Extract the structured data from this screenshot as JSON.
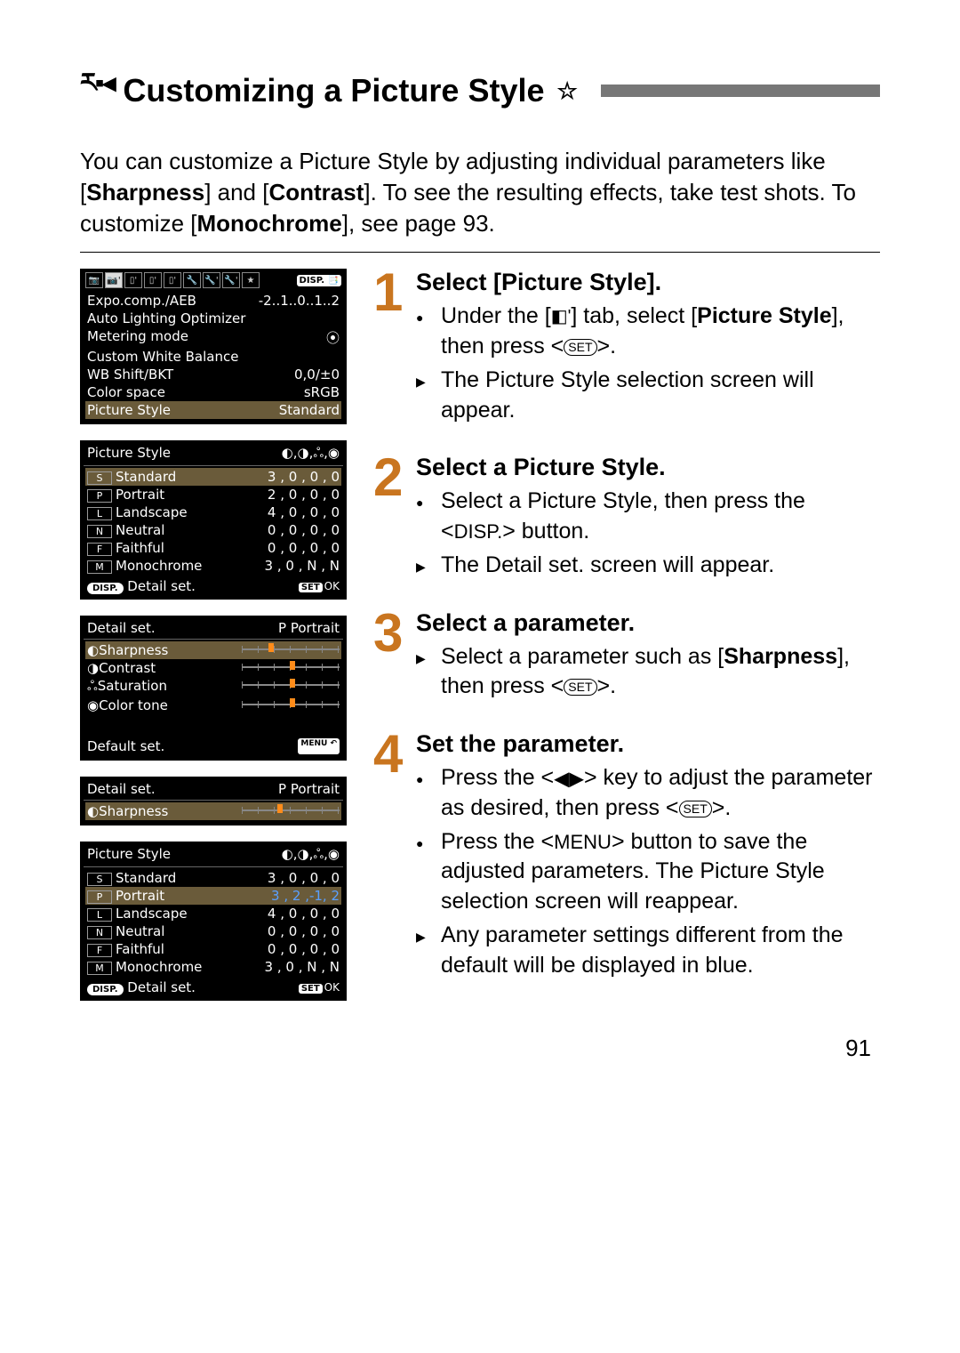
{
  "title": "Customizing a Picture Style",
  "intro_pre": "You can customize a Picture Style by adjusting individual parameters like [",
  "intro_b1": "Sharpness",
  "intro_mid": "] and [",
  "intro_b2": "Contrast",
  "intro_post": "]. To see the resulting effects, take test shots. To customize [",
  "intro_b3": "Monochrome",
  "intro_end": "], see page 93.",
  "page_number": "91",
  "screen1": {
    "disp_badge": "DISP. 📑",
    "rows": [
      {
        "label": "Expo.comp./AEB",
        "value": "-2..1..0..1..2"
      },
      {
        "label": "Auto Lighting Optimizer",
        "value": ""
      },
      {
        "label": "Metering mode",
        "value": "⦿"
      },
      {
        "label": "Custom White Balance",
        "value": ""
      },
      {
        "label": "WB Shift/BKT",
        "value": "0,0/±0"
      },
      {
        "label": "Color space",
        "value": "sRGB"
      },
      {
        "label": "Picture Style",
        "value": "Standard",
        "sel": true
      }
    ]
  },
  "screen2": {
    "header_l": "Picture Style",
    "header_r": "◐,◑,ஃ,◉",
    "rows": [
      {
        "icon": "S",
        "label": "Standard",
        "value": "3 , 0 , 0 , 0",
        "sel": true
      },
      {
        "icon": "P",
        "label": "Portrait",
        "value": "2 , 0 , 0 , 0"
      },
      {
        "icon": "L",
        "label": "Landscape",
        "value": "4 , 0 , 0 , 0"
      },
      {
        "icon": "N",
        "label": "Neutral",
        "value": "0 , 0 , 0 , 0"
      },
      {
        "icon": "F",
        "label": "Faithful",
        "value": "0 , 0 , 0 , 0"
      },
      {
        "icon": "M",
        "label": "Monochrome",
        "value": "3 , 0 , N , N"
      }
    ],
    "footer_l": "DISP.",
    "footer_l2": "Detail set.",
    "footer_r": "OK"
  },
  "screen3": {
    "header_l": "Detail set.",
    "header_r": "P  Portrait",
    "rows": [
      {
        "icon": "◐",
        "label": "Sharpness",
        "sel": true
      },
      {
        "icon": "◑",
        "label": "Contrast"
      },
      {
        "icon": "ஃ",
        "label": "Saturation"
      },
      {
        "icon": "◉",
        "label": "Color tone"
      }
    ],
    "default_label": "Default set.",
    "menu_badge": "MENU ↶"
  },
  "screen4": {
    "header_l": "Detail set.",
    "header_r": "P  Portrait",
    "row_icon": "◐",
    "row_label": "Sharpness"
  },
  "screen5": {
    "header_l": "Picture Style",
    "header_r": "◐,◑,ஃ,◉",
    "rows": [
      {
        "icon": "S",
        "label": "Standard",
        "value": "3 , 0 , 0 , 0"
      },
      {
        "icon": "P",
        "label": "Portrait",
        "value": "3 , 2 ,-1, 2",
        "sel": true,
        "blue": true
      },
      {
        "icon": "L",
        "label": "Landscape",
        "value": "4 , 0 , 0 , 0"
      },
      {
        "icon": "N",
        "label": "Neutral",
        "value": "0 , 0 , 0 , 0"
      },
      {
        "icon": "F",
        "label": "Faithful",
        "value": "0 , 0 , 0 , 0"
      },
      {
        "icon": "M",
        "label": "Monochrome",
        "value": "3 , 0 , N , N"
      }
    ],
    "footer_l": "DISP.",
    "footer_l2": "Detail set.",
    "footer_r": "OK"
  },
  "steps": {
    "1": {
      "title": "Select [Picture Style].",
      "b1_pre": "Under the [",
      "b1_post": "] tab, select [",
      "b1_bold": "Picture Style",
      "b1_end": "], then press <",
      "b1_close": ">.",
      "b2": "The Picture Style selection screen will appear."
    },
    "2": {
      "title": "Select a Picture Style.",
      "b1_pre": "Select a Picture Style, then press the <",
      "b1_disp": "DISP.",
      "b1_post": "> button.",
      "b2": "The Detail set. screen will appear."
    },
    "3": {
      "title": "Select a parameter.",
      "b1_pre": "Select a parameter such as [",
      "b1_bold": "Sharpness",
      "b1_mid": "], then press <",
      "b1_close": ">."
    },
    "4": {
      "title": "Set the parameter.",
      "b1_pre": "Press the <",
      "b1_mid": "> key to adjust the parameter as desired, then press <",
      "b1_close": ">.",
      "b2_pre": "Press the <",
      "b2_menu": "MENU",
      "b2_post": "> button to save the adjusted parameters. The Picture Style selection screen will reappear.",
      "b3": "Any parameter settings different from the default will be displayed in blue."
    }
  }
}
